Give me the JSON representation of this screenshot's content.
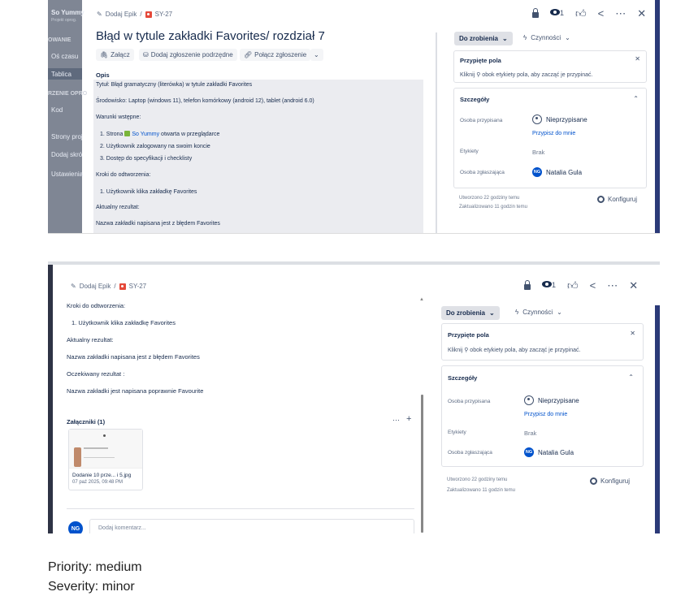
{
  "panel1": {
    "sidebar": {
      "project_name": "So Yummy",
      "project_sub": "Projekt oprog.",
      "section_planning": "OWANIE",
      "items": [
        "Oś czasu",
        "Tablica"
      ],
      "section_dev": "RZENIE OPRO",
      "items2": [
        "Kod",
        "Strony proj",
        "Dodaj skró",
        "Ustawienia"
      ]
    },
    "breadcrumb": {
      "epic": "Dodaj Epik",
      "separator": "/",
      "issue_key": "SY-27"
    },
    "watch_count": "1",
    "title": "Błąd w tytule zakładki Favorites/ rozdział 7",
    "toolbar": {
      "attach": "Załącz",
      "add_child": "Dodaj zgłoszenie podrzędne",
      "link": "Połącz zgłoszenie"
    },
    "description": {
      "heading": "Opis",
      "lines": [
        "Tytuł: Błąd gramatyczny (literówka) w tytule zakładki Favorites",
        "Środowisko: Laptop (windows 11), telefon komórkowy (android 12), tablet (android 6.0)",
        "Warunki wstępne:",
        "1. Strona",
        "So Yummy",
        "otwarta w przeglądarce",
        "2. Użytkownik zalogowany na swoim koncie",
        "3.  Dostęp do specyfikacji i checklisty",
        "Kroki do odtworzenia:",
        "1. Użytkownik klika zakładkę Favorites",
        "Aktualny rezultat:",
        "Nazwa zakładki napisana jest z błędem Favorites"
      ]
    }
  },
  "side": {
    "status": "Do zrobienia",
    "actions": "Czynności",
    "pinned_title": "Przypięte pola",
    "pinned_text": "Kliknij ⚲ obok etykiety pola, aby zacząć je przypinać.",
    "details_title": "Szczegóły",
    "assignee_label": "Osoba przypisana",
    "assignee_value": "Nieprzypisane",
    "assign_me": "Przypisz do mnie",
    "labels_label": "Etykiety",
    "labels_value": "Brak",
    "reporter_label": "Osoba zgłaszająca",
    "reporter_initials": "NG",
    "reporter_value": "Natalia Gula",
    "created": "Utworzono 22 godziny temu",
    "updated": "Zaktualizowano 11 godzin temu",
    "configure": "Konfiguruj"
  },
  "panel2": {
    "lines": [
      "Kroki do odtworzenia:",
      "1. Użytkownik klika zakładkę Favorites",
      "Aktualny rezultat:",
      "Nazwa zakładki napisana jest z błędem Favorites",
      "Oczekiwany rezultat :",
      "Nazwa zakładki jest napisana poprawnie Favourite"
    ],
    "attachments_title": "Załączniki (1)",
    "attachment": {
      "name": "Dodanie 10 prze... i 5.jpg",
      "date": "07 paź 2025, 09:48 PM"
    },
    "comment_initials": "NG",
    "comment_placeholder": "Dodaj komentarz..."
  },
  "footer": {
    "priority": "Priority: medium",
    "severity": "Severity: minor"
  },
  "colors": {
    "accent": "#0052cc",
    "bug": "#e5493a",
    "sidebar": "#7f8694"
  }
}
